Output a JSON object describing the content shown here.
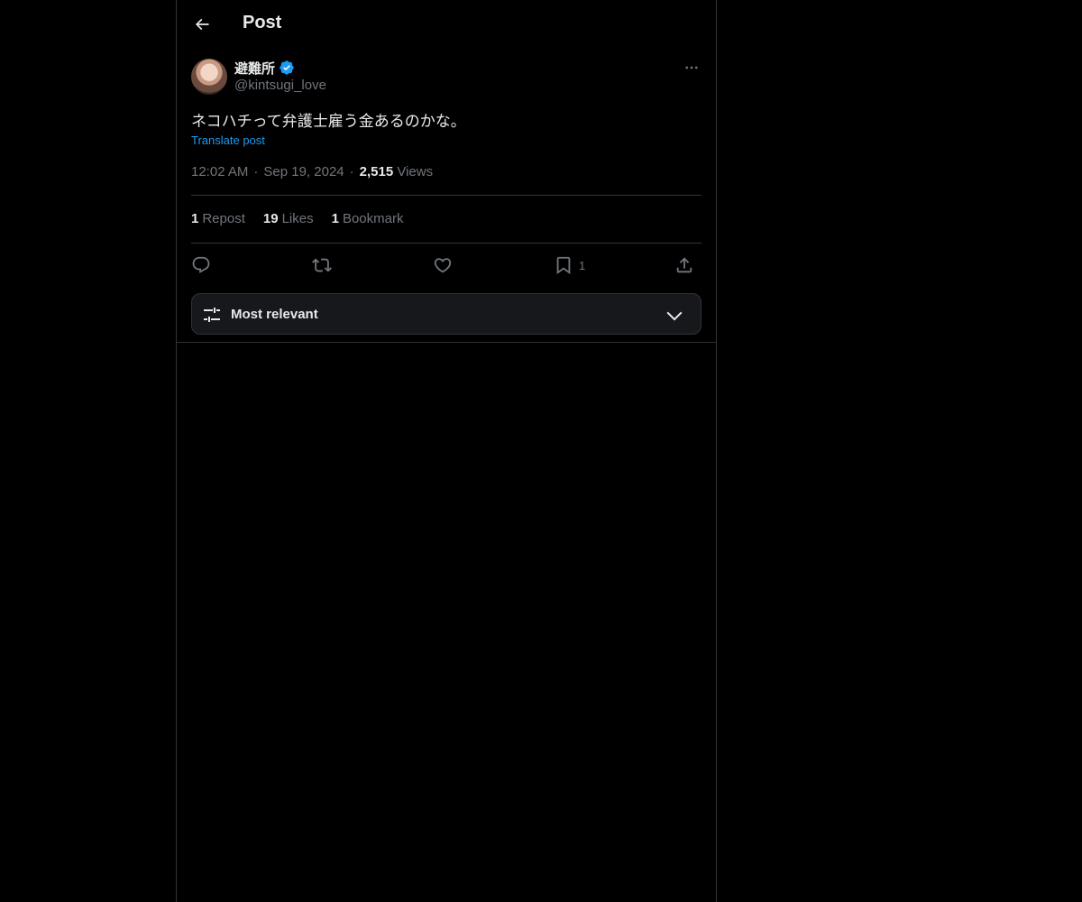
{
  "header": {
    "title": "Post",
    "back_icon": "arrow-left-icon"
  },
  "author": {
    "display_name": "避難所",
    "handle": "@kintsugi_love",
    "verified": true,
    "verified_color": "#1d9bf0"
  },
  "post": {
    "text": "ネコハチって弁護士雇う金あるのかな。",
    "translate_label": "Translate post",
    "time": "12:02 AM",
    "date": "Sep 19, 2024",
    "views_count": "2,515",
    "views_label": "Views",
    "separator": "·"
  },
  "stats": {
    "reposts_count": "1",
    "reposts_label": "Repost",
    "likes_count": "19",
    "likes_label": "Likes",
    "bookmarks_count": "1",
    "bookmarks_label": "Bookmark"
  },
  "actions": {
    "reply_icon": "reply-icon",
    "repost_icon": "repost-icon",
    "like_icon": "heart-icon",
    "bookmark_icon": "bookmark-icon",
    "bookmark_count": "1",
    "share_icon": "share-icon"
  },
  "sort": {
    "label": "Most relevant",
    "icon": "sliders-icon",
    "chevron": "chevron-down-icon"
  },
  "colors": {
    "background": "#000000",
    "text": "#e7e9ea",
    "muted": "#71767b",
    "link": "#1d9bf0",
    "border": "#2f3336"
  }
}
